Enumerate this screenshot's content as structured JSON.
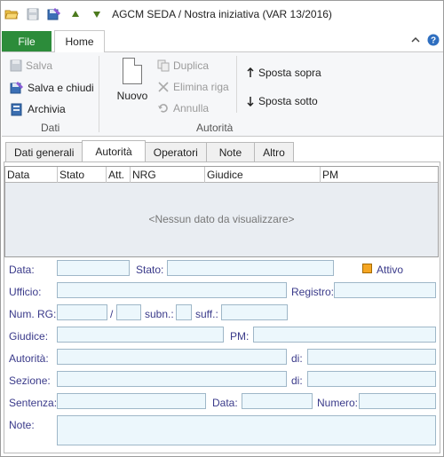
{
  "window": {
    "title": "AGCM SEDA / Nostra iniziativa (VAR 13/2016)"
  },
  "quick_access": [
    "folder-open-icon",
    "save-icon",
    "save-close-icon",
    "move-up-icon",
    "move-down-icon"
  ],
  "ribbon_tabs": {
    "file": "File",
    "home": "Home"
  },
  "ribbon": {
    "dati": {
      "salva": "Salva",
      "salva_chiudi": "Salva e chiudi",
      "archivia": "Archivia",
      "label": "Dati"
    },
    "autorita": {
      "nuovo": "Nuovo",
      "duplica": "Duplica",
      "elimina_riga": "Elimina riga",
      "annulla": "Annulla",
      "label": "Autorità"
    },
    "sposta": {
      "sopra": "Sposta sopra",
      "sotto": "Sposta sotto"
    }
  },
  "page_tabs": [
    "Dati generali",
    "Autorità",
    "Operatori",
    "Note",
    "Altro"
  ],
  "active_tab": "Autorità",
  "grid": {
    "columns": [
      "Data",
      "Stato",
      "Att.",
      "NRG",
      "Giudice",
      "PM"
    ],
    "empty_text": "<Nessun dato da visualizzare>"
  },
  "form": {
    "data": "Data:",
    "stato": "Stato:",
    "attivo": "Attivo",
    "ufficio": "Ufficio:",
    "registro": "Registro:",
    "num_rg": "Num. RG:",
    "slash": "/",
    "subn": "subn.:",
    "suff": "suff.:",
    "giudice": "Giudice:",
    "pm": "PM:",
    "autorita": "Autorità:",
    "di1": "di:",
    "sezione": "Sezione:",
    "di2": "di:",
    "sentenza": "Sentenza:",
    "data2": "Data:",
    "numero": "Numero:",
    "note": "Note:"
  },
  "colors": {
    "file_tab": "#2c8c3a",
    "field_bg": "#ecf7fc",
    "label": "#3a3a8a",
    "checkbox": "#f5a623"
  }
}
